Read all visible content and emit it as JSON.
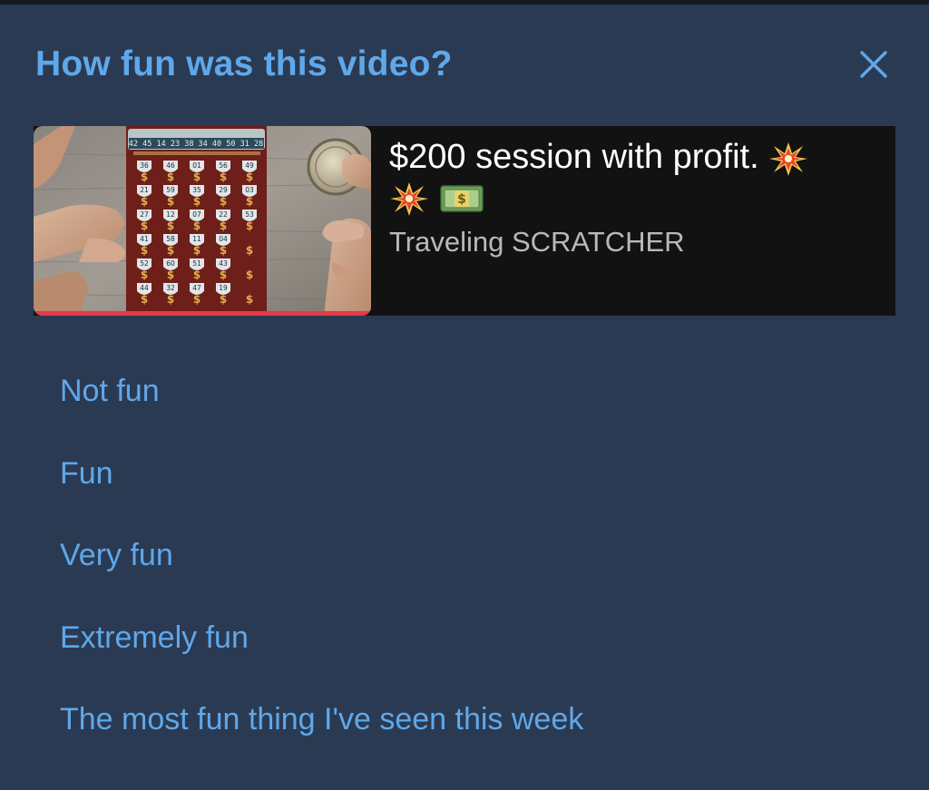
{
  "dialog": {
    "title": "How fun was this video?",
    "close_icon": "close-icon",
    "accent_color": "#5fa8ea",
    "background_color": "#2b3a53"
  },
  "video": {
    "title": "$200 session with profit.",
    "title_emojis": [
      "collision-emoji",
      "collision-emoji",
      "money-banknote-emoji"
    ],
    "channel": "Traveling SCRATCHER",
    "progress_fraction": 1.0,
    "thumbnail": {
      "winning_numbers": "42 45 14 23 38 34 40 50 31 28",
      "grid_numbers": [
        [
          "36",
          "46",
          "01",
          "56",
          "49"
        ],
        [
          "21",
          "59",
          "35",
          "29",
          "03"
        ],
        [
          "27",
          "12",
          "07",
          "22",
          "53"
        ],
        [
          "41",
          "58",
          "11",
          "04",
          ""
        ],
        [
          "52",
          "60",
          "51",
          "43",
          ""
        ],
        [
          "44",
          "32",
          "47",
          "19",
          ""
        ]
      ]
    }
  },
  "options": [
    "Not fun",
    "Fun",
    "Very fun",
    "Extremely fun",
    "The most fun thing I've seen this week"
  ]
}
